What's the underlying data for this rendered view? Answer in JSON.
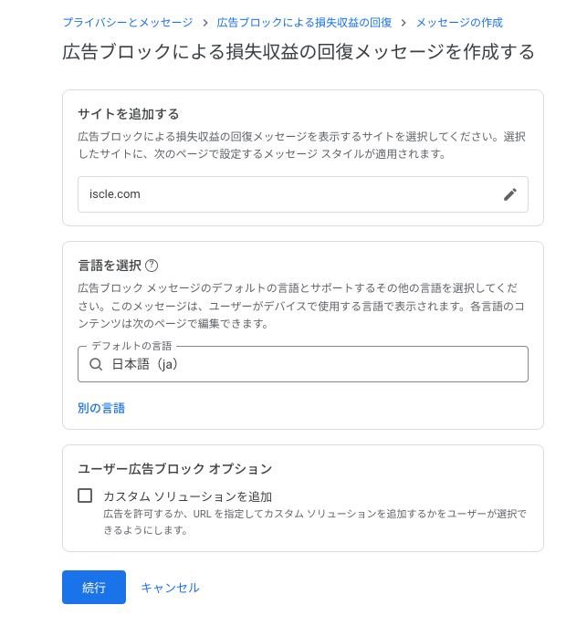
{
  "breadcrumb": {
    "items": [
      {
        "label": "プライバシーとメッセージ"
      },
      {
        "label": "広告ブロックによる損失収益の回復"
      },
      {
        "label": "メッセージの作成"
      }
    ]
  },
  "page": {
    "title": "広告ブロックによる損失収益の回復メッセージを作成する"
  },
  "site_card": {
    "title": "サイトを追加する",
    "desc": "広告ブロックによる損失収益の回復メッセージを表示するサイトを選択してください。選択したサイトに、次のページで設定するメッセージ スタイルが適用されます。",
    "site": "iscle.com"
  },
  "lang_card": {
    "title": "言語を選択",
    "desc": "広告ブロック メッセージのデフォルトの言語とサポートするその他の言語を選択してください。このメッセージは、ユーザーがデバイスで使用する言語で表示されます。各言語のコンテンツは次のページで編集できます。",
    "field_label": "デフォルトの言語",
    "value": "日本語（ja）",
    "other_link": "別の言語"
  },
  "option_card": {
    "title": "ユーザー広告ブロック オプション",
    "check_label": "カスタム ソリューションを追加",
    "check_sub": "広告を許可するか、URL を指定してカスタム ソリューションを追加するかをユーザーが選択できるようにします。"
  },
  "actions": {
    "continue": "続行",
    "cancel": "キャンセル"
  }
}
